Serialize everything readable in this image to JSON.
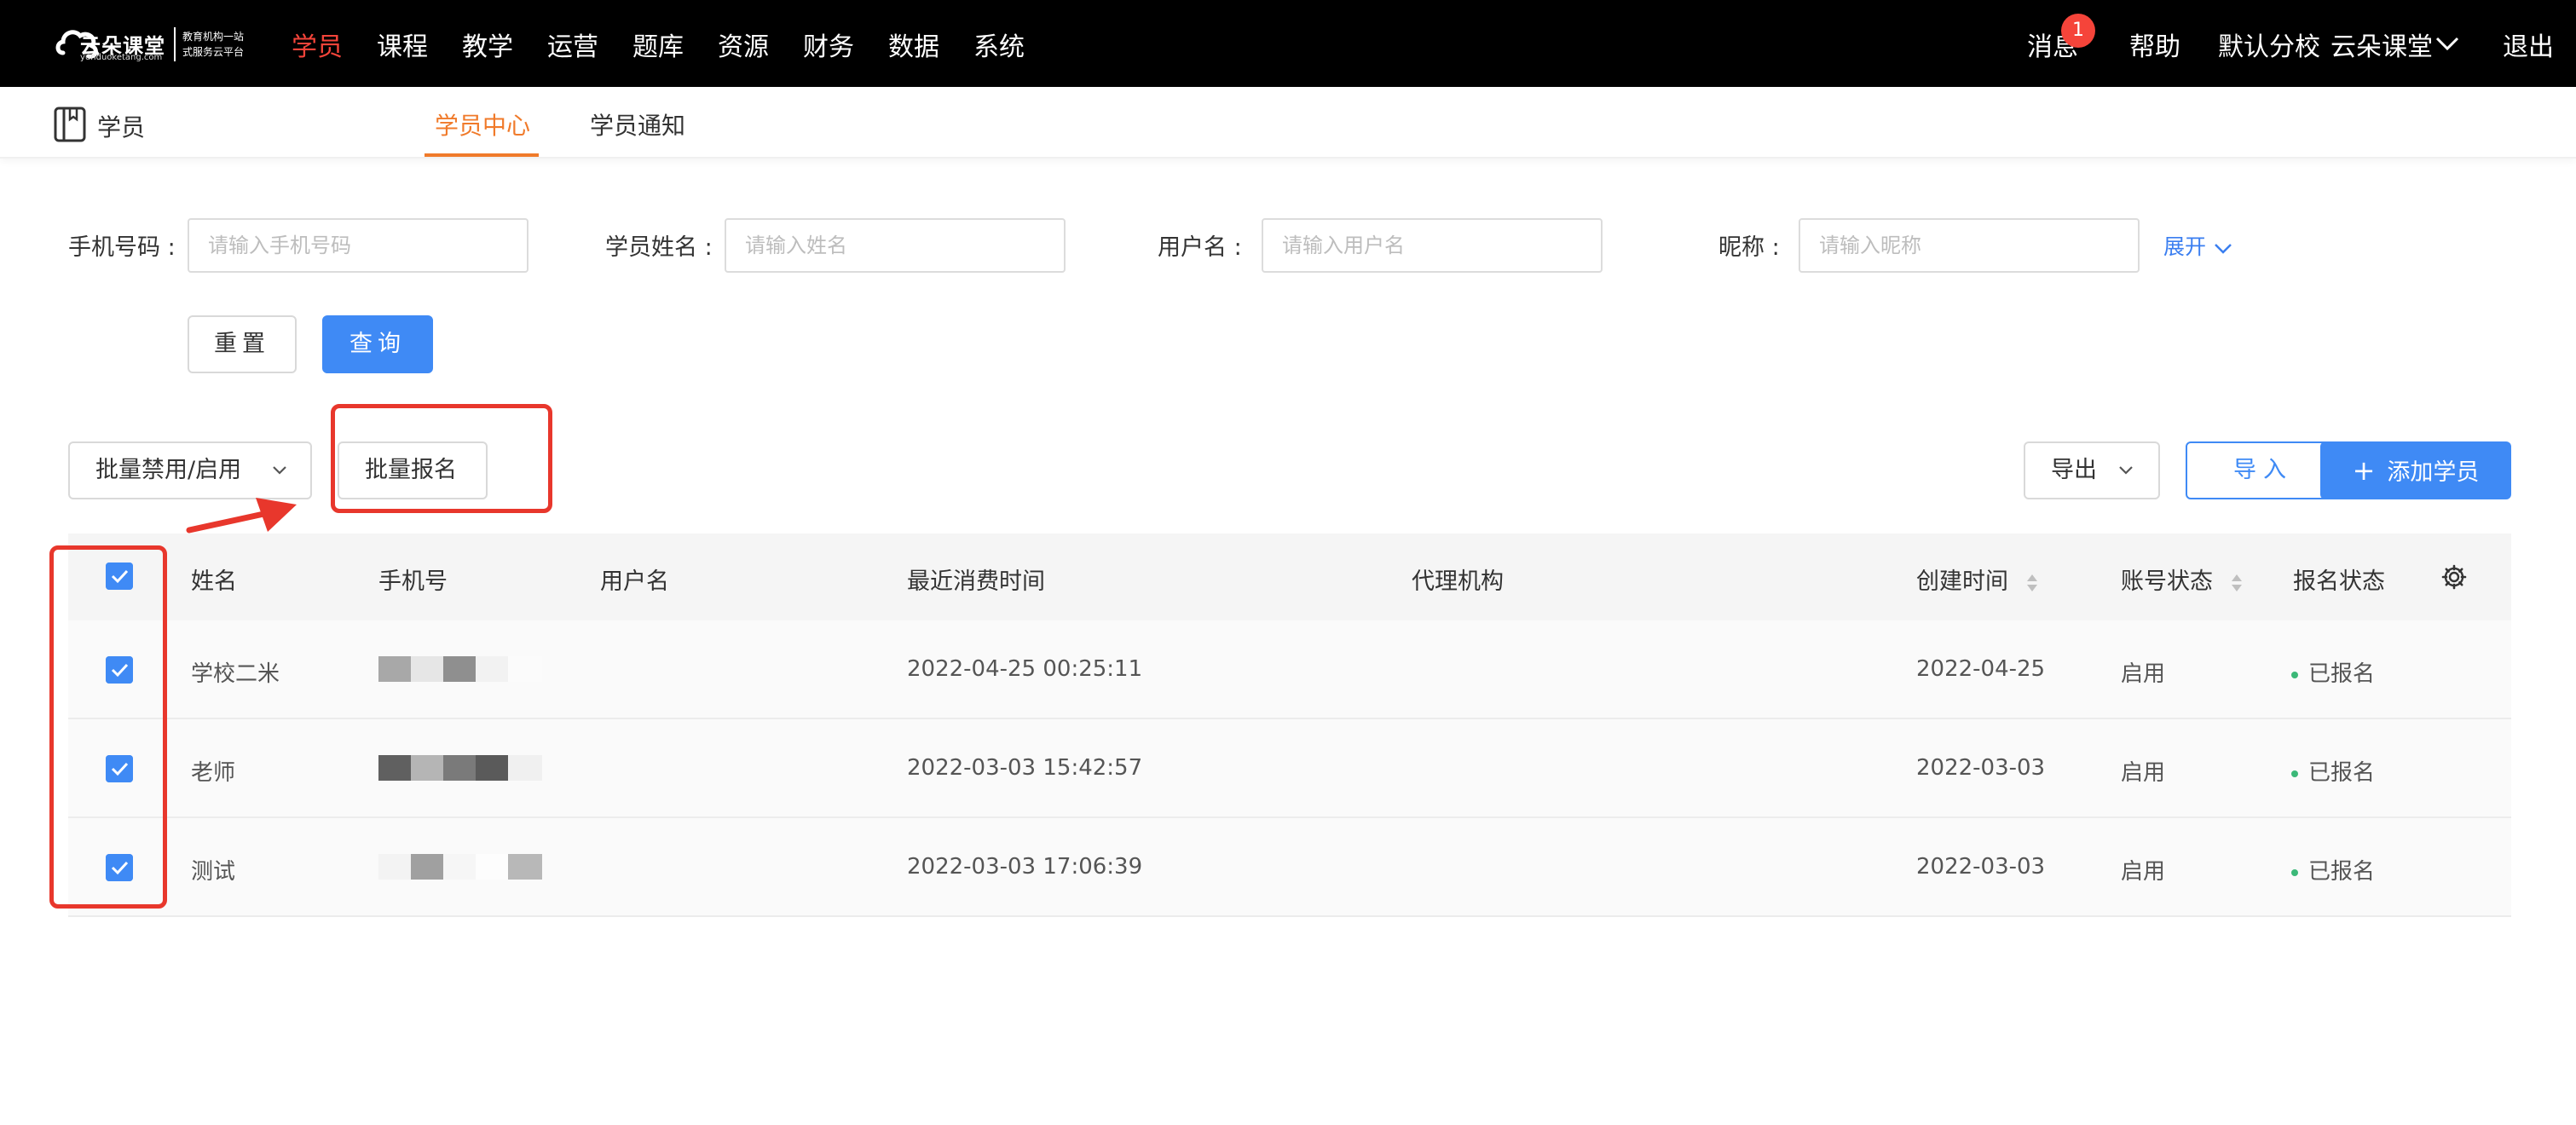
{
  "brand": {
    "name": "云朵课堂",
    "url": "yunduoketang.com",
    "slogan_line1": "教育机构一站",
    "slogan_line2": "式服务云平台"
  },
  "nav": {
    "items": [
      {
        "label": "学员",
        "active": true
      },
      {
        "label": "课程"
      },
      {
        "label": "教学"
      },
      {
        "label": "运营"
      },
      {
        "label": "题库"
      },
      {
        "label": "资源"
      },
      {
        "label": "财务"
      },
      {
        "label": "数据"
      },
      {
        "label": "系统"
      }
    ],
    "messages_label": "消息",
    "messages_count": "1",
    "help_label": "帮助",
    "campus_label": "默认分校",
    "account_label": "云朵课堂",
    "logout_label": "退出"
  },
  "subheader": {
    "title": "学员",
    "tabs": [
      {
        "label": "学员中心",
        "active": true
      },
      {
        "label": "学员通知"
      }
    ]
  },
  "filters": {
    "phone": {
      "label": "手机号码 :",
      "placeholder": "请输入手机号码",
      "value": ""
    },
    "name": {
      "label": "学员姓名 :",
      "placeholder": "请输入姓名",
      "value": ""
    },
    "username": {
      "label": "用户名 :",
      "placeholder": "请输入用户名",
      "value": ""
    },
    "nickname": {
      "label": "昵称 :",
      "placeholder": "请输入昵称",
      "value": ""
    },
    "expand_label": "展开",
    "reset_label": "重置",
    "query_label": "查询"
  },
  "toolbar": {
    "batch_disable_label": "批量禁用/启用",
    "batch_enroll_label": "批量报名",
    "export_label": "导出",
    "import_label": "导入",
    "add_label": "添加学员"
  },
  "table": {
    "columns": [
      "姓名",
      "手机号",
      "用户名",
      "最近消费时间",
      "代理机构",
      "创建时间",
      "账号状态",
      "报名状态"
    ],
    "rows": [
      {
        "name": "学校二米",
        "phone": "",
        "username": "",
        "last_purchase": "2022-04-25 00:25:11",
        "agency": "",
        "created": "2022-04-25",
        "account_status": "启用",
        "enroll_status": "已报名",
        "checked": true
      },
      {
        "name": "老师",
        "phone": "",
        "username": "",
        "last_purchase": "2022-03-03 15:42:57",
        "agency": "",
        "created": "2022-03-03",
        "account_status": "启用",
        "enroll_status": "已报名",
        "checked": true
      },
      {
        "name": "测试",
        "phone": "",
        "username": "",
        "last_purchase": "2022-03-03 17:06:39",
        "agency": "",
        "created": "2022-03-03",
        "account_status": "启用",
        "enroll_status": "已报名",
        "checked": true
      }
    ],
    "all_checked": true
  },
  "colors": {
    "topbar_bg": "#000000",
    "nav_active": "#f5443a",
    "tab_active": "#f07a2a",
    "primary": "#3f8af5",
    "annotation": "#e8372c",
    "status_dot": "#3bb878"
  }
}
